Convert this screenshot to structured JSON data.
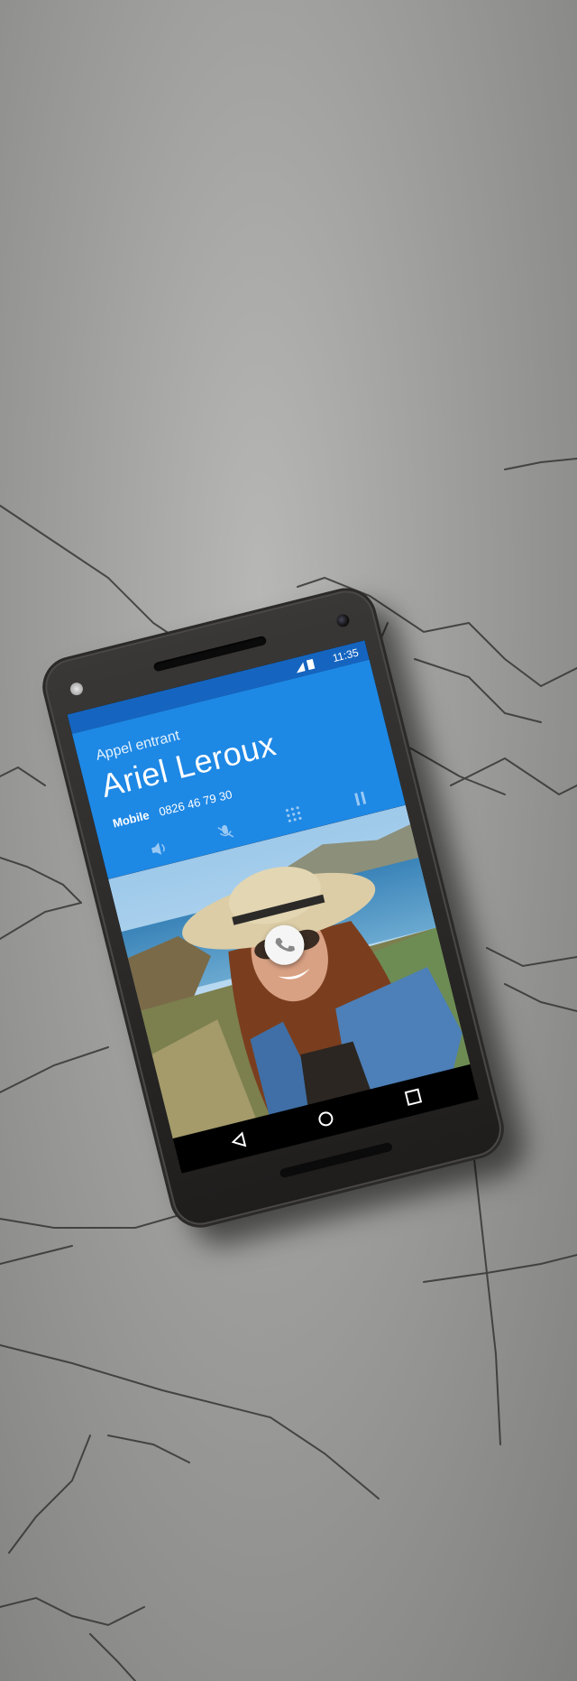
{
  "status_bar": {
    "time": "11:35",
    "icons": [
      "signal-icon",
      "battery-icon"
    ]
  },
  "incoming_call": {
    "label": "Appel entrant",
    "caller_name": "Ariel Leroux",
    "number_type": "Mobile",
    "phone_number": "0826 46 79 30",
    "controls": [
      "speaker-icon",
      "mute-icon",
      "dialpad-icon",
      "pause-icon"
    ],
    "answer_icon": "phone-handset-icon"
  },
  "navigation": {
    "buttons": [
      "back-icon",
      "home-icon",
      "recents-icon"
    ]
  },
  "colors": {
    "header_blue": "#1e88e5",
    "status_blue": "#1565c0",
    "background_gray": "#9d9d9b"
  }
}
